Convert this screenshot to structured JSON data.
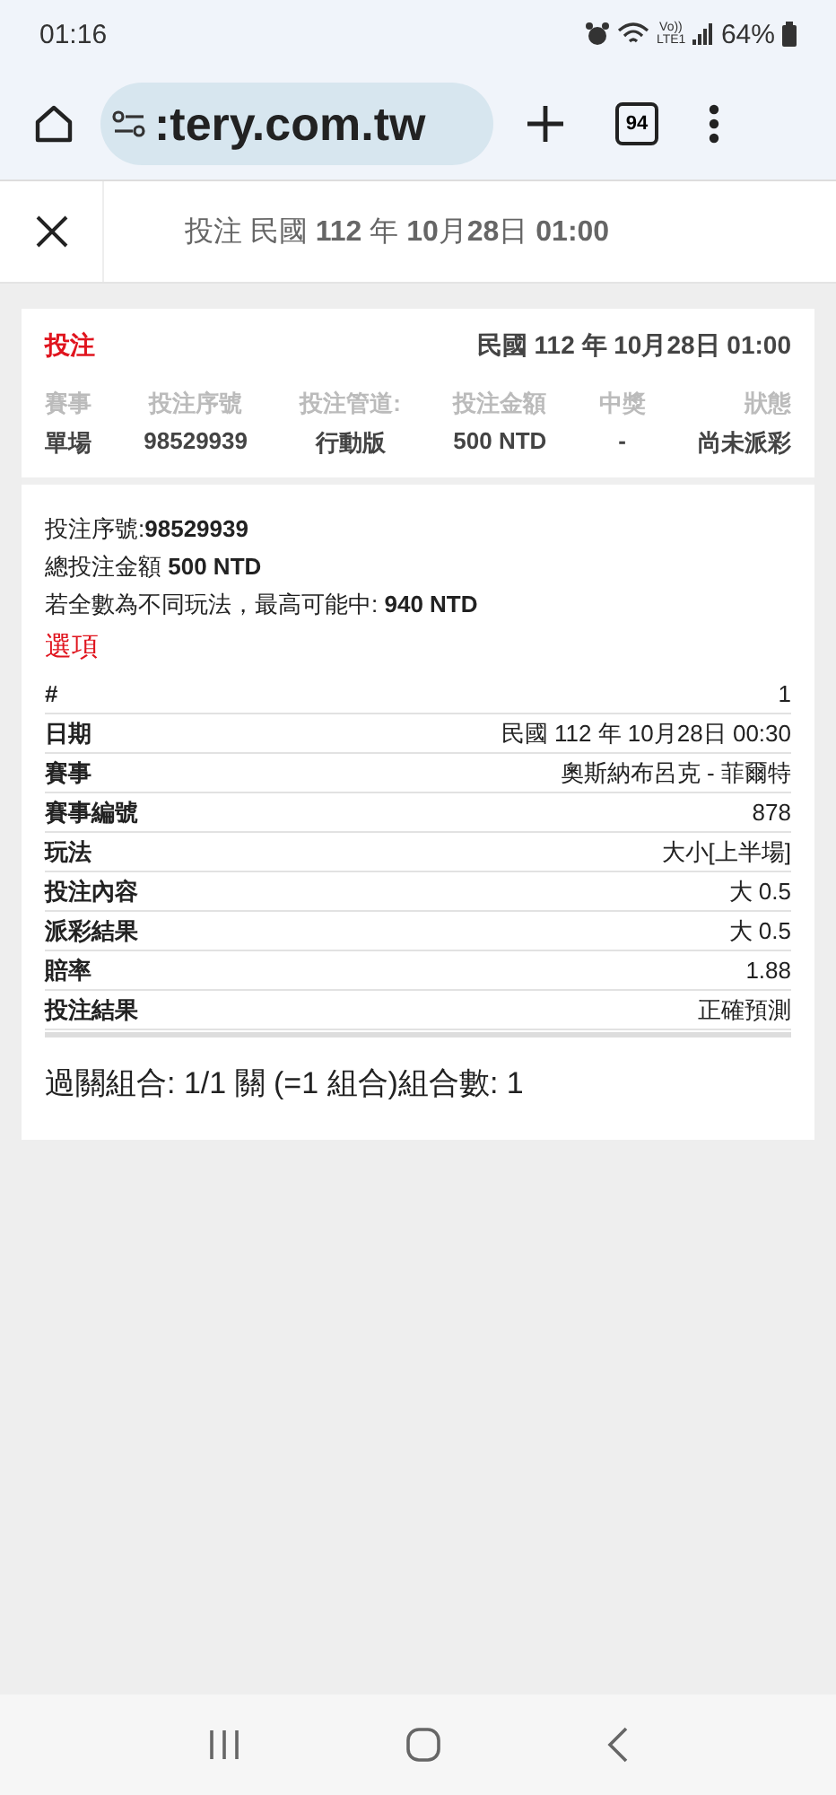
{
  "status_bar": {
    "time": "01:16",
    "network_label": "Vo)) LTE1",
    "battery": "64%"
  },
  "browser": {
    "url": ":tery.com.tw",
    "tab_count": "94"
  },
  "header": {
    "title": "投注 民國 **112** 年 **10**月**28**日 **01:00**"
  },
  "summary": {
    "title": "投注",
    "date": "民國 112 年 10月28日 01:00",
    "columns": [
      {
        "label": "賽事",
        "value": "單場"
      },
      {
        "label": "投注序號",
        "value": "98529939"
      },
      {
        "label": "投注管道:",
        "value": "行動版"
      },
      {
        "label": "投注金額",
        "value": "500 NTD"
      },
      {
        "label": "中獎",
        "value": "-"
      },
      {
        "label": "狀態",
        "value": "尚未派彩"
      }
    ]
  },
  "details": {
    "lines": [
      "投注序號:**98529939**",
      "總投注金額 **500 NTD**",
      "若全數為不同玩法，最高可能中: **940 NTD**"
    ],
    "section_title": "選項",
    "rows": [
      {
        "label": "#",
        "value": "1"
      },
      {
        "label": "日期",
        "value": "民國 112 年 10月28日 00:30"
      },
      {
        "label": "賽事",
        "value": "奧斯納布呂克 - 菲爾特"
      },
      {
        "label": "賽事編號",
        "value": "878"
      },
      {
        "label": "玩法",
        "value": "大小[上半場]"
      },
      {
        "label": "投注內容",
        "value": "大 0.5"
      },
      {
        "label": "派彩結果",
        "value": "大 0.5"
      },
      {
        "label": "賠率",
        "value": "1.88"
      },
      {
        "label": "投注結果",
        "value": "正確預測"
      }
    ],
    "combination": "過關組合: 1/1 關 (=1 組合)組合數: 1"
  }
}
